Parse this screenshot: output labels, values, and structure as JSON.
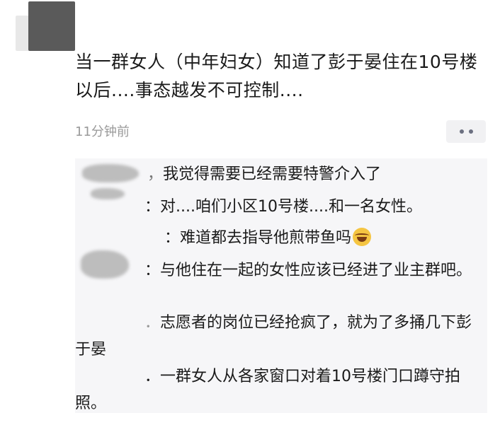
{
  "post": {
    "text": "当一群女人（中年妇女）知道了彭于晏住在10号楼以后....事态越发不可控制....",
    "time": "11分钟前"
  },
  "comments": [
    {
      "prefix": "，",
      "text": "我觉得需要已经需要特警介入了"
    },
    {
      "prefix": "：",
      "text": "对....咱们小区10号楼....和一名女性。"
    },
    {
      "prefix": "：",
      "text": "难道都去指导他煎带鱼吗"
    },
    {
      "prefix": "：",
      "text": "与他住在一起的女性应该已经进了业主群吧。"
    },
    {
      "prefix": "．",
      "text": "志愿者的岗位已经抢疯了，就为了多捅几下彭于晏"
    },
    {
      "prefix": "．",
      "text": "一群女人从各家窗口对着10号楼门口蹲守拍照。"
    }
  ],
  "icons": {
    "more": "more-dots-icon",
    "emoji": "laugh-cry-emoji-icon"
  }
}
